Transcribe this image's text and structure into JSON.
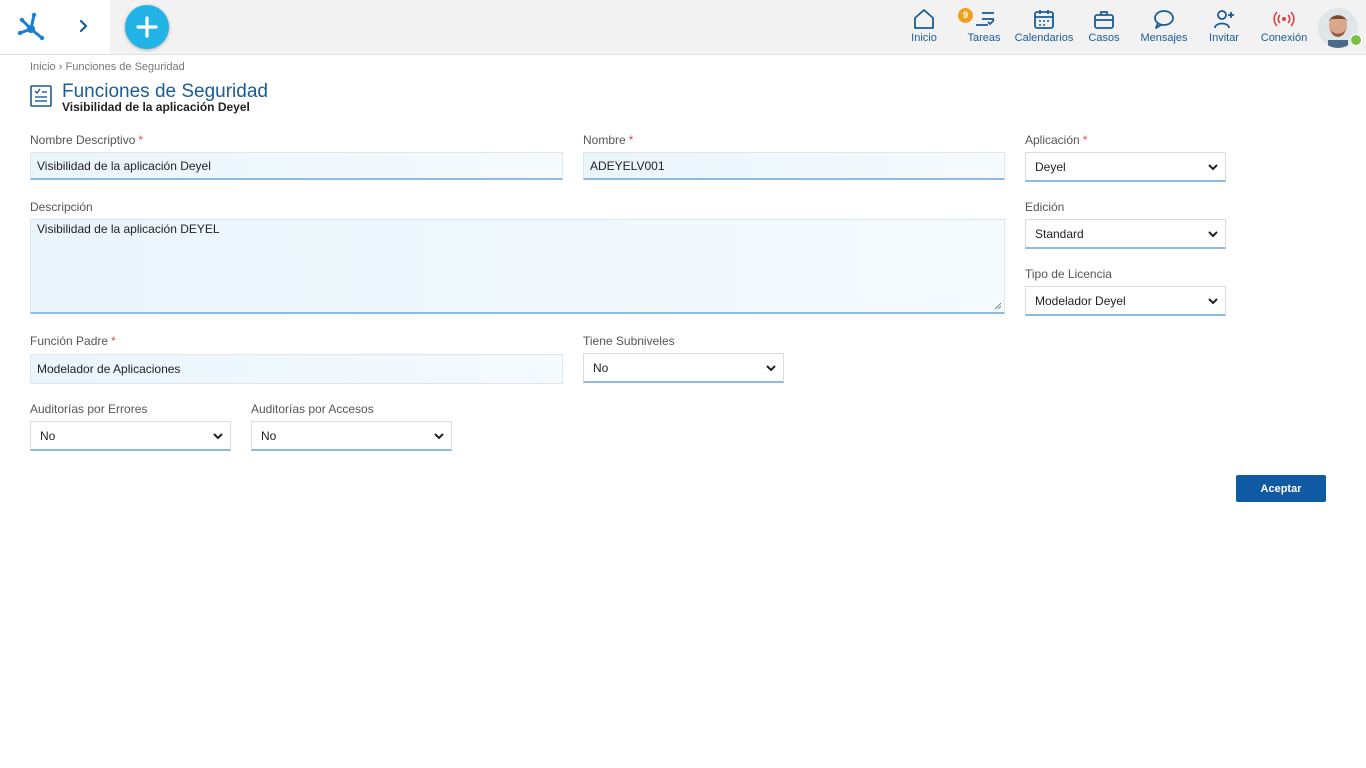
{
  "header": {
    "nav": [
      {
        "label": "Inicio",
        "icon": "home-icon"
      },
      {
        "label": "Tareas",
        "icon": "tasks-icon",
        "badge": "9"
      },
      {
        "label": "Calendarios",
        "icon": "calendar-icon"
      },
      {
        "label": "Casos",
        "icon": "briefcase-icon"
      },
      {
        "label": "Mensajes",
        "icon": "chat-icon"
      },
      {
        "label": "Invitar",
        "icon": "add-user-icon"
      },
      {
        "label": "Conexión",
        "icon": "connection-icon"
      }
    ],
    "accent": "#1a5c96",
    "add_button_color": "#22b4e6"
  },
  "breadcrumb": {
    "home": "Inicio",
    "separator": "›",
    "current": "Funciones de Seguridad"
  },
  "page": {
    "title": "Funciones de Seguridad",
    "subtitle": "Visibilidad de la aplicación Deyel"
  },
  "form": {
    "nombre_descriptivo": {
      "label": "Nombre Descriptivo",
      "required": "*",
      "value": "Visibilidad de la aplicación Deyel"
    },
    "nombre": {
      "label": "Nombre",
      "required": "*",
      "value": "ADEYELV001"
    },
    "aplicacion": {
      "label": "Aplicación",
      "required": "*",
      "value": "Deyel"
    },
    "descripcion": {
      "label": "Descripción",
      "value": "Visibilidad de la aplicación DEYEL"
    },
    "edicion": {
      "label": "Edición",
      "value": "Standard"
    },
    "tipo_licencia": {
      "label": "Tipo de Licencia",
      "value": "Modelador Deyel"
    },
    "funcion_padre": {
      "label": "Función Padre",
      "required": "*",
      "value": "Modelador de Aplicaciones"
    },
    "tiene_subniveles": {
      "label": "Tiene Subniveles",
      "value": "No"
    },
    "auditorias_errores": {
      "label": "Auditorías por Errores",
      "value": "No"
    },
    "auditorias_accesos": {
      "label": "Auditorías por Accesos",
      "value": "No"
    }
  },
  "actions": {
    "accept_label": "Aceptar",
    "accept_color": "#0f5aa3"
  }
}
